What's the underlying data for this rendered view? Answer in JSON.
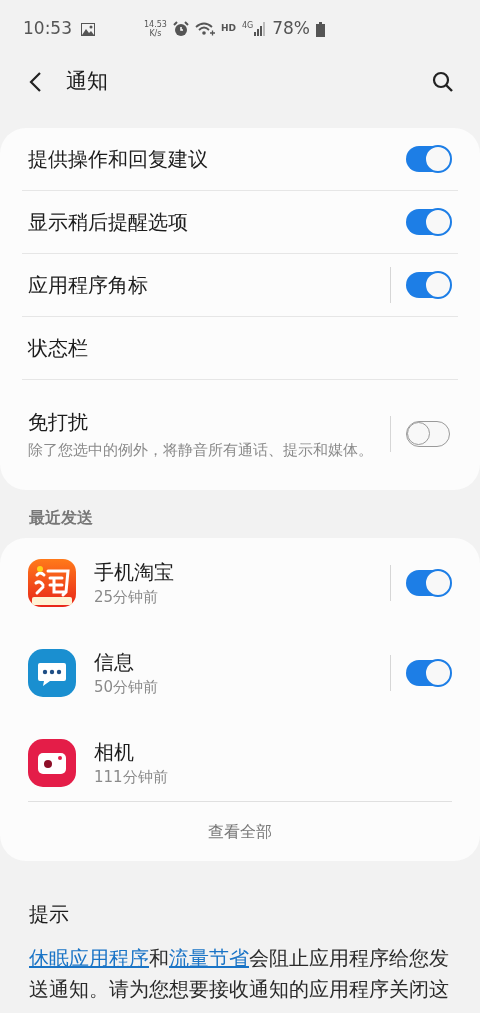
{
  "status_bar": {
    "time": "10:53",
    "speed": "14.53",
    "speed_unit": "K/s",
    "hd": "HD",
    "network": "4G",
    "battery": "78%"
  },
  "header": {
    "title": "通知"
  },
  "settings": [
    {
      "label": "提供操作和回复建议",
      "kind": "toggle",
      "on": true,
      "split": false
    },
    {
      "label": "显示稍后提醒选项",
      "kind": "toggle",
      "on": true,
      "split": false
    },
    {
      "label": "应用程序角标",
      "kind": "toggle",
      "on": true,
      "split": true
    },
    {
      "label": "状态栏",
      "kind": "link"
    },
    {
      "label": "免打扰",
      "description": "除了您选中的例外，将静音所有通话、提示和媒体。",
      "kind": "toggle",
      "on": false,
      "split": true
    }
  ],
  "recent": {
    "title": "最近发送",
    "apps": [
      {
        "name": "手机淘宝",
        "time": "25分钟前",
        "toggle": true,
        "on": true
      },
      {
        "name": "信息",
        "time": "50分钟前",
        "toggle": true,
        "on": true
      },
      {
        "name": "相机",
        "time": "111分钟前",
        "toggle": false
      }
    ],
    "see_all": "查看全部"
  },
  "tips": {
    "title": "提示",
    "segments": [
      {
        "text": "休眠应用程序",
        "link": true
      },
      {
        "text": "和",
        "link": false
      },
      {
        "text": "流量节省",
        "link": true
      },
      {
        "text": "会阻止应用程序给您发送通知。请为您想要接收通知的应用程序关闭这",
        "link": false
      }
    ]
  }
}
